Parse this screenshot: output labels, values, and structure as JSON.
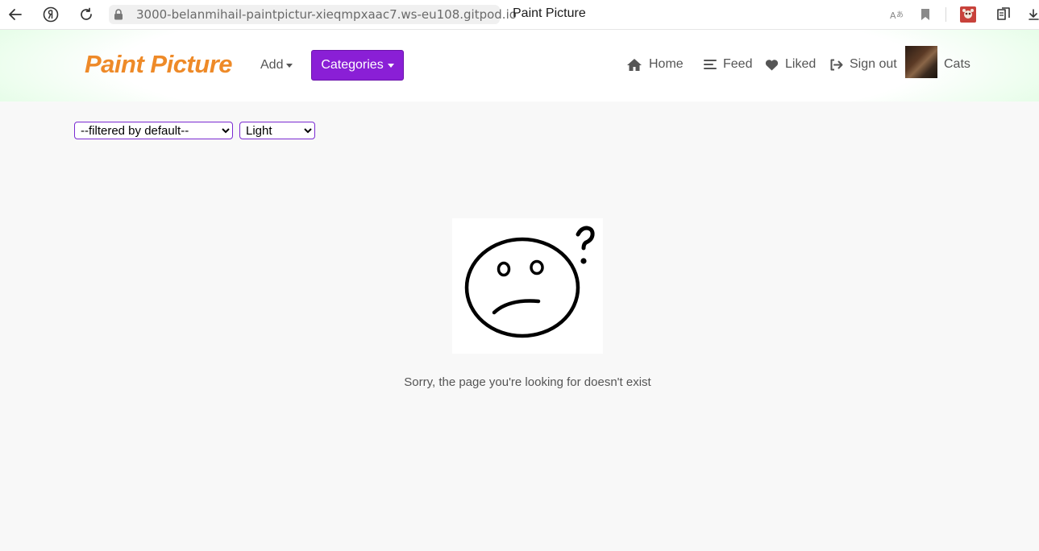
{
  "browser": {
    "url": "3000-belanmihail-paintpictur-xieqmpxaac7.ws-eu108.gitpod.io",
    "tab_title": "Paint Picture",
    "icons": [
      "back-icon",
      "yandex-icon",
      "reload-icon",
      "lock-icon",
      "translate-icon",
      "bookmark-icon",
      "extension-icon",
      "collections-icon",
      "download-icon"
    ]
  },
  "navbar": {
    "brand": "Paint Picture",
    "add_label": "Add",
    "categories_label": "Categories",
    "links": {
      "home": "Home",
      "feed": "Feed",
      "liked": "Liked",
      "sign_out": "Sign out",
      "profile": "Cats"
    },
    "colors": {
      "brand": "#ee8a28",
      "categories_bg": "#8a1fd6"
    }
  },
  "filters": {
    "sort_selected": "--filtered by default--",
    "theme_selected": "Light"
  },
  "main": {
    "image_icon": "sad-face-question-icon",
    "message": "Sorry, the page you're looking for doesn't exist"
  }
}
